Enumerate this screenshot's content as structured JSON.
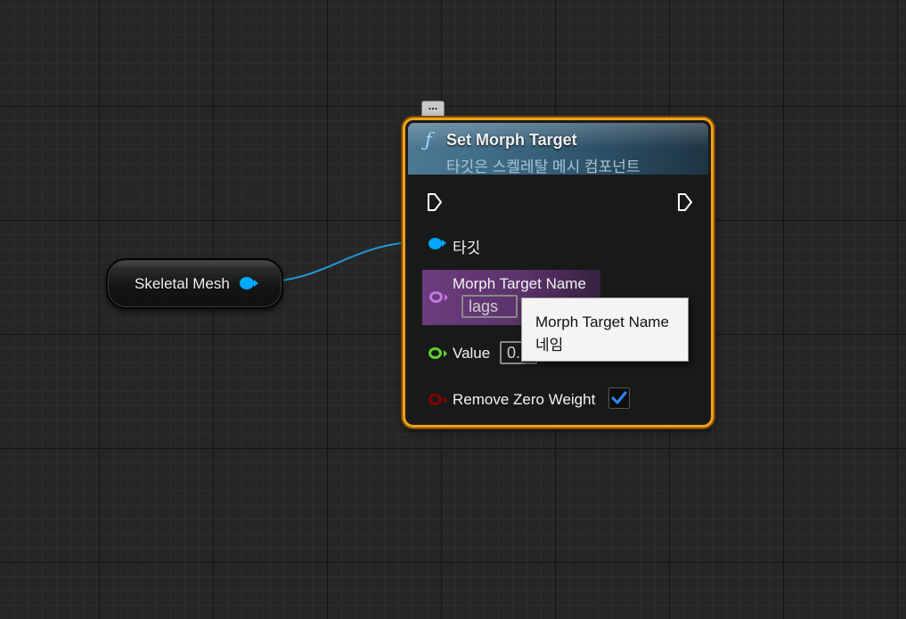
{
  "variable_node": {
    "label": "Skeletal Mesh"
  },
  "function_node": {
    "title": "Set Morph Target",
    "subtitle": "타깃은 스켈레탈 메시 컴포넌트",
    "pins": {
      "target_label": "타깃",
      "morph_target_name_label": "Morph Target Name",
      "morph_target_name_value": "lags",
      "value_label": "Value",
      "value_value": "0.",
      "remove_zero_weight_label": "Remove Zero Weight",
      "remove_zero_weight_checked": true
    }
  },
  "tooltip": {
    "title": "Morph Target Name",
    "body": "네임"
  },
  "colors": {
    "selection_outline": "#f2a01a",
    "object_pin": "#00a8ff",
    "name_pin": "#c27adf",
    "float_pin": "#5fd22a",
    "bool_pin": "#8a0000",
    "checkmark": "#2b8cff"
  },
  "icons": {
    "function": "function-f-icon",
    "comment": "comment-bubble-icon",
    "exec_in": "exec-input-arrow-icon",
    "exec_out": "exec-output-arrow-icon",
    "check": "checkmark-icon"
  }
}
